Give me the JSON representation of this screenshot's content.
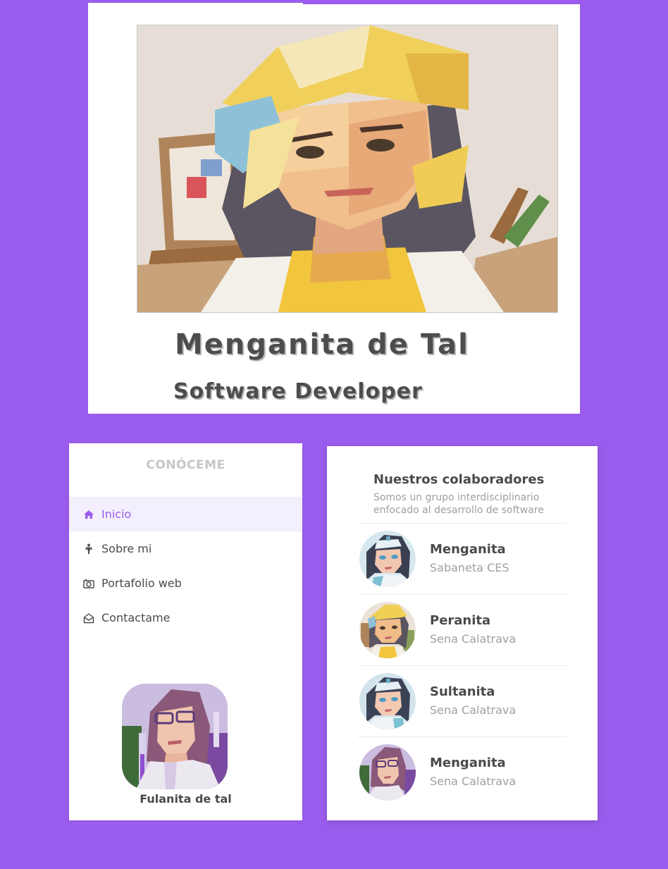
{
  "hero": {
    "portrait_alt": "Menganita de Tal portrait",
    "name": "Menganita de Tal",
    "role": "Software Developer"
  },
  "sidebar": {
    "title": "CONÓCEME",
    "items": [
      {
        "label": "Inicio",
        "icon": "home-icon",
        "active": true
      },
      {
        "label": "Sobre mi",
        "icon": "person-icon",
        "active": false
      },
      {
        "label": "Portafolio web",
        "icon": "camera-icon",
        "active": false
      },
      {
        "label": "Contactame",
        "icon": "envelope-open-icon",
        "active": false
      }
    ],
    "profile": {
      "name": "Fulanita de tal"
    }
  },
  "collaborators": {
    "title": "Nuestros colaboradores",
    "subtitle": "Somos un grupo interdisciplinario enfocado al desarrollo de software",
    "people": [
      {
        "name": "Menganita",
        "org": "Sabaneta CES",
        "avatar": "nurse-avatar"
      },
      {
        "name": "Peranita",
        "org": "Sena Calatrava",
        "avatar": "painter-avatar"
      },
      {
        "name": "Sultanita",
        "org": "Sena Calatrava",
        "avatar": "nurse-avatar"
      },
      {
        "name": "Menganita",
        "org": "Sena Calatrava",
        "avatar": "scientist-avatar"
      }
    ]
  },
  "colors": {
    "background": "#9a5cec",
    "accent": "#9a5cec",
    "card": "#ffffff",
    "text": "#4a4a4a",
    "muted": "#a0a0a0"
  }
}
